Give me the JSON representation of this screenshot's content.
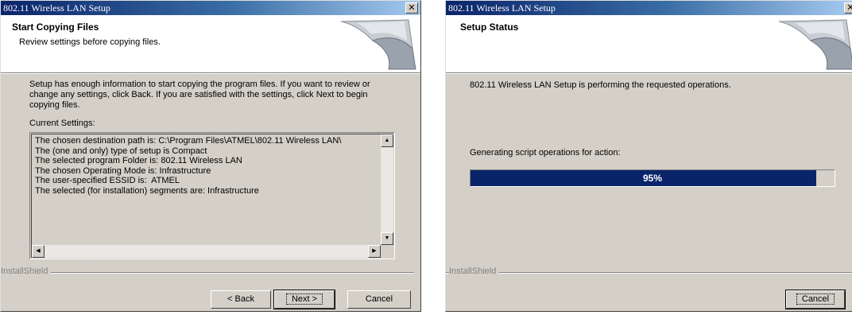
{
  "dialog1": {
    "title": "802.11 Wireless LAN Setup",
    "close_glyph": "✕",
    "header_title": "Start Copying Files",
    "header_subtitle": "Review settings before copying files.",
    "description_lines": [
      "Setup has enough information to start copying the program files.  If you want to review or",
      "change any settings, click Back.  If you are satisfied with the settings, click Next to begin",
      "copying files."
    ],
    "current_settings_label": "Current Settings:",
    "settings_lines": [
      "The chosen destination path is: C:\\Program Files\\ATMEL\\802.11 Wireless LAN\\",
      "The (one and only) type of setup is Compact",
      "The selected program Folder is: 802.11 Wireless LAN",
      "The chosen Operating Mode is: Infrastructure",
      "The user-specified ESSID is:  ATMEL",
      "The selected (for installation) segments are: Infrastructure"
    ],
    "brand": "InstallShield",
    "back_button": "< Back",
    "next_button": "Next >",
    "cancel_button": "Cancel"
  },
  "dialog2": {
    "title": "802.11 Wireless LAN Setup",
    "close_glyph": "✕",
    "header_title": "Setup Status",
    "status_text": "802.11 Wireless LAN Setup is performing the requested operations.",
    "action_text": "Generating script operations for action:",
    "progress_label": "95%",
    "progress_fraction": 0.95,
    "brand": "InstallShield",
    "cancel_button": "Cancel"
  },
  "colors": {
    "titlebar_start": "#0a246a",
    "titlebar_end": "#a6caf0",
    "dialog_face": "#d4d0c8",
    "progress_fill": "#0a246a"
  },
  "icons": [
    "close-icon",
    "scroll-up-icon",
    "scroll-down-icon",
    "scroll-left-icon",
    "scroll-right-icon",
    "installshield-header-graphic"
  ]
}
